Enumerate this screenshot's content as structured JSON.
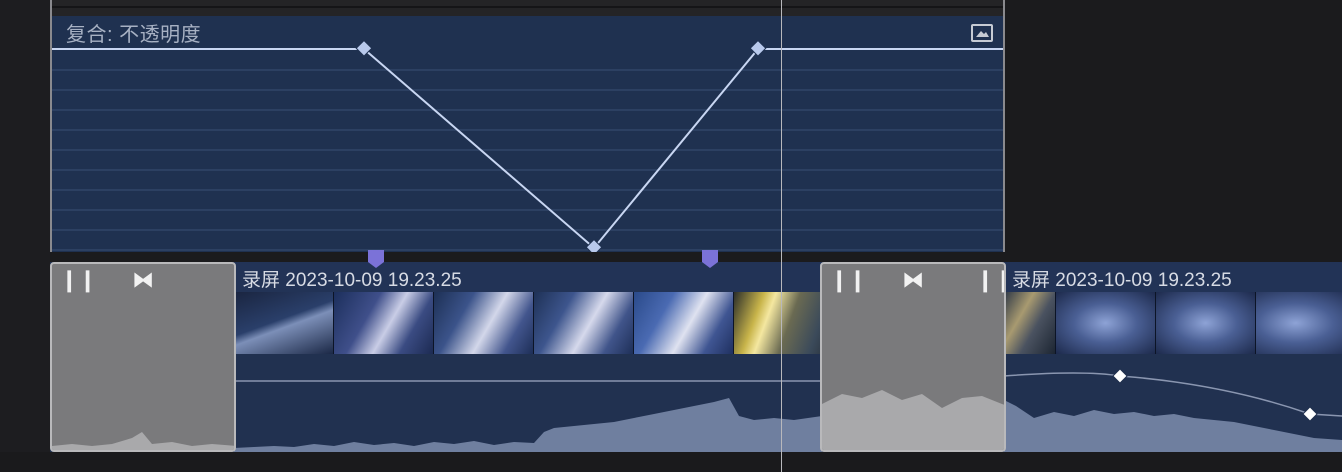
{
  "opacity_editor": {
    "title": "复合: 不透明度",
    "toggle_icon": "collapse-editor-icon"
  },
  "clips": [
    {
      "title": "录屏 2023-10-09 19.23.25"
    },
    {
      "title": "录屏 2023-10-09 19.23.25"
    }
  ],
  "colors": {
    "editor_bg": "#1f3150",
    "curve": "#c8d6f2",
    "marker": "#7b72d8",
    "clip_bg": "#223356",
    "transition_bg": "#7a7a7c",
    "waveform": "#6f7f9f",
    "playhead": "#b8b8bc"
  }
}
